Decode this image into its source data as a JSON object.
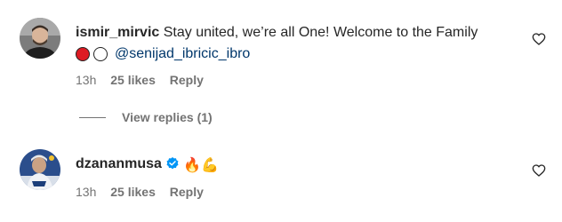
{
  "comments": [
    {
      "username": "ismir_mirvic",
      "text": "Stay united, we’re all One! Welcome to the Family",
      "mention": "@senijad_ibricic_ibro",
      "time": "13h",
      "likes": "25 likes",
      "reply_label": "Reply",
      "view_replies_label": "View replies (1)"
    },
    {
      "username": "dzananmusa",
      "verified": true,
      "emojis": [
        "🔥",
        "💪"
      ],
      "time": "13h",
      "likes": "25 likes",
      "reply_label": "Reply"
    }
  ],
  "colors": {
    "text": "#262626",
    "meta": "#737373",
    "mention": "#00376b",
    "verified": "#0095f6",
    "red_circle": "#dd1b23"
  }
}
